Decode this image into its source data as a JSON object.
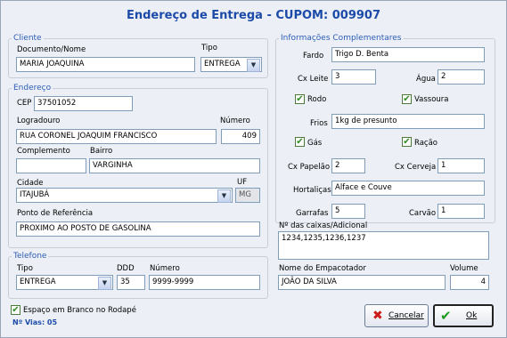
{
  "title": "Endereço de Entrega - CUPOM: 009907",
  "cliente": {
    "legend": "Cliente",
    "doc_label": "Documento/Nome",
    "doc_value": "MARIA JOAQUINA",
    "tipo_label": "Tipo",
    "tipo_value": "ENTREGA"
  },
  "endereco": {
    "legend": "Endereço",
    "cep_label": "CEP",
    "cep_value": "37501052",
    "logradouro_label": "Logradouro",
    "logradouro_value": "RUA CORONEL JOAQUIM FRANCISCO",
    "numero_label": "Número",
    "numero_value": "409",
    "complemento_label": "Complemento",
    "complemento_value": "",
    "bairro_label": "Bairro",
    "bairro_value": "VARGINHA",
    "cidade_label": "Cidade",
    "cidade_value": "ITAJUBÁ",
    "uf_label": "UF",
    "uf_value": "MG",
    "referencia_label": "Ponto de Referência",
    "referencia_value": "PROXIMO AO POSTO DE GASOLINA"
  },
  "telefone": {
    "legend": "Telefone",
    "tipo_label": "Tipo",
    "tipo_value": "ENTREGA",
    "ddd_label": "DDD",
    "ddd_value": "35",
    "numero_label": "Número",
    "numero_value": "9999-9999"
  },
  "info": {
    "legend": "Informações Complementares",
    "fardo_label": "Fardo",
    "fardo_value": "Trigo D. Benta",
    "cxleite_label": "Cx Leite",
    "cxleite_value": "3",
    "agua_label": "Água",
    "agua_value": "2",
    "rodo_label": "Rodo",
    "vassoura_label": "Vassoura",
    "frios_label": "Frios",
    "frios_value": "1kg de presunto",
    "gas_label": "Gás",
    "racao_label": "Ração",
    "cxpapelao_label": "Cx Papelão",
    "cxpapelao_value": "2",
    "cxcerveja_label": "Cx Cerveja",
    "cxcerveja_value": "1",
    "hortalicas_label": "Hortaliças",
    "hortalicas_value": "Alface e Couve",
    "garrafas_label": "Garrafas",
    "garrafas_value": "5",
    "carvao_label": "Carvão",
    "carvao_value": "1"
  },
  "caixas": {
    "label": "Nº das caixas/Adicional",
    "value": "1234,1235,1236,1237"
  },
  "empacotador": {
    "label": "Nome do Empacotador",
    "value": "JOÃO DA SILVA",
    "volume_label": "Volume",
    "volume_value": "4"
  },
  "footer": {
    "espaco_label": "Espaço em Branco no Rodapé",
    "vias_text": "Nº Vias: 05",
    "cancelar_label": "Cancelar",
    "ok_label": "Ok"
  }
}
